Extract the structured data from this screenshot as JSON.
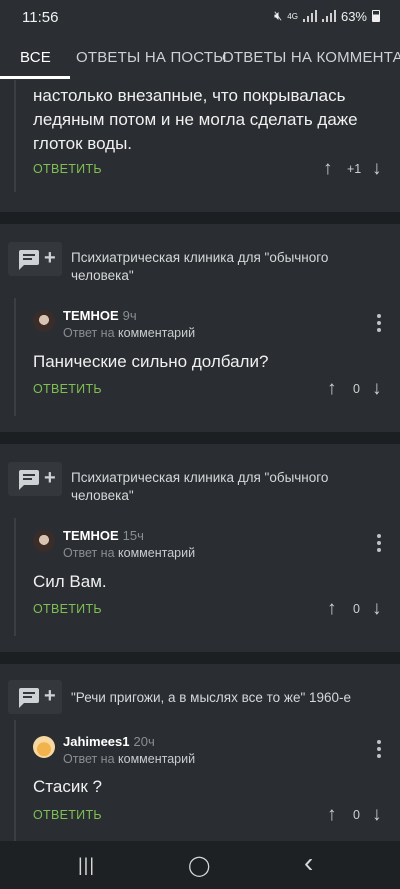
{
  "status": {
    "time": "11:56",
    "network": "4G",
    "battery": "63%"
  },
  "tabs": [
    {
      "label": "ВСЕ"
    },
    {
      "label": "ОТВЕТЫ НА ПОСТЫ"
    },
    {
      "label": "ОТВЕТЫ НА КОММЕНТАР"
    }
  ],
  "first_comment": {
    "lines": [
      "настолько внезапные, что покрывалась",
      "ледяным потом и не могла сделать даже",
      "глоток воды."
    ],
    "reply_label": "ОТВЕТИТЬ",
    "rating": "+1"
  },
  "threads": [
    {
      "post_title_1": "Психиатрическая клиника для \"обычного",
      "post_title_2": "человека\"",
      "author": "ТЕМНОЕ",
      "time": "9ч",
      "reply_prefix": "Ответ на",
      "reply_target": "комментарий",
      "text": "Панические сильно долбали?",
      "reply_label": "ОТВЕТИТЬ",
      "rating": "0"
    },
    {
      "post_title_1": "Психиатрическая клиника для \"обычного",
      "post_title_2": "человека\"",
      "author": "ТЕМНОЕ",
      "time": "15ч",
      "reply_prefix": "Ответ на",
      "reply_target": "комментарий",
      "text": "Сил Вам.",
      "reply_label": "ОТВЕТИТЬ",
      "rating": "0"
    },
    {
      "post_title_1": "\"Речи пригожи, а в мыслях все то же\" 1960-е",
      "post_title_2": "",
      "author": "Jahimees1",
      "time": "20ч",
      "reply_prefix": "Ответ на",
      "reply_target": "комментарий",
      "text": "Стасик ?",
      "reply_label": "ОТВЕТИТЬ",
      "rating": "0"
    }
  ],
  "nav": {
    "recents": "|||",
    "home": "◯",
    "back": "‹"
  }
}
